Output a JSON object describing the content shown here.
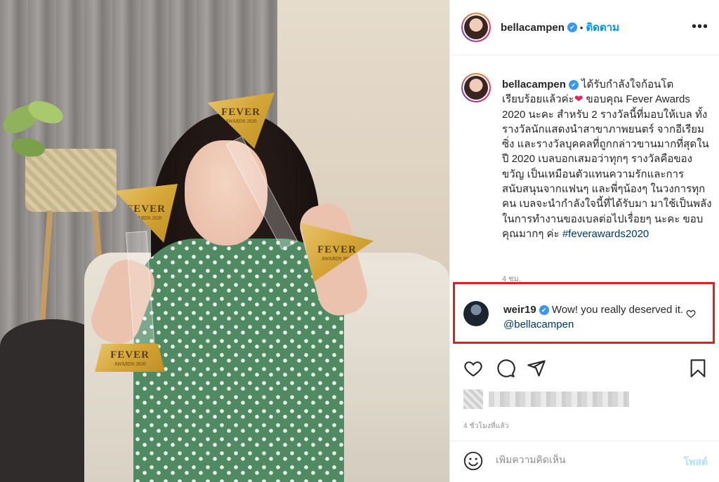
{
  "header": {
    "username": "bellacampen",
    "verified_badge": "✔",
    "separator": "•",
    "follow_label": "ติดตาม",
    "more_label": "•••"
  },
  "photo": {
    "trophy_title": "FEVER",
    "trophy_subtitle": "AWARDS 2020"
  },
  "caption": {
    "username": "bellacampen",
    "line_before_heart": "ได้รับกำลังใจก้อนโต เรียบร้อยแล้วค่ะ",
    "heart": "❤",
    "body": "ขอบคุณ Fever Awards 2020 นะคะ สำหรับ 2 รางวัลนี้ที่มอบให้เบล ทั้งรางวัลนักแสดงนำสาขาภาพยนตร์ จากอีเรียมซิ่ง และรางวัลบุคคลที่ถูกกล่าวขานมากที่สุดในปี 2020 เบลบอกเสมอว่าทุกๆ รางวัลคือของขวัญ เป็นเหมือนตัวแทนความรักและการสนับสนุนจากแฟนๆ และพี่ๆน้องๆ ในวงการทุกคน เบลจะนำกำลังใจนี้ที่ได้รับมา มาใช้เป็นพลังในการทำงานของเบลต่อไปเรื่อยๆ นะคะ ขอบคุณมากๆ ค่ะ",
    "hashtag": "#feverawards2020",
    "time": "4 ชม."
  },
  "comment": {
    "username": "weir19",
    "text": "Wow! you really deserved it.",
    "mention": "@bellacampen"
  },
  "footer": {
    "post_time": "4 ชั่วโมงที่แล้ว",
    "comment_placeholder": "เพิ่มความคิดเห็น",
    "post_label": "โพสต์"
  },
  "icons": [
    "heart-icon",
    "comment-icon",
    "share-icon",
    "bookmark-icon",
    "emoji-icon",
    "verified-icon",
    "more-icon"
  ],
  "colors": {
    "link_blue": "#0095f6",
    "hashtag_navy": "#00376b",
    "highlight_red": "#e02020",
    "post_disabled": "#b2dffc",
    "verified_blue": "#3897f0"
  }
}
